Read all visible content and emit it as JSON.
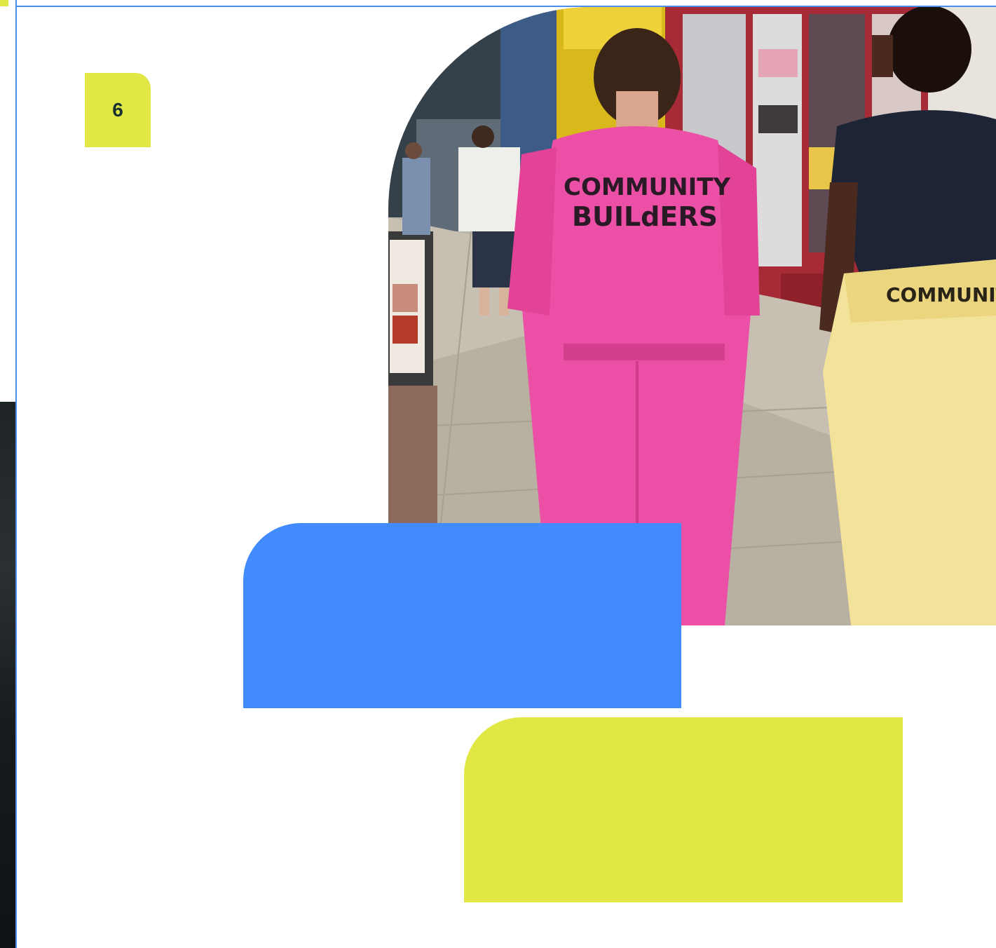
{
  "page": {
    "number": "6"
  },
  "photo": {
    "overall_text": "COMMUNITY",
    "overall_text_2": "BUILdERS",
    "trousers_text": "COMMUNITY"
  },
  "colors": {
    "accent_yellow": "#e1e845",
    "accent_blue": "#418bfc",
    "rule_blue": "#4a8ef0",
    "badge_text": "#17302d"
  }
}
